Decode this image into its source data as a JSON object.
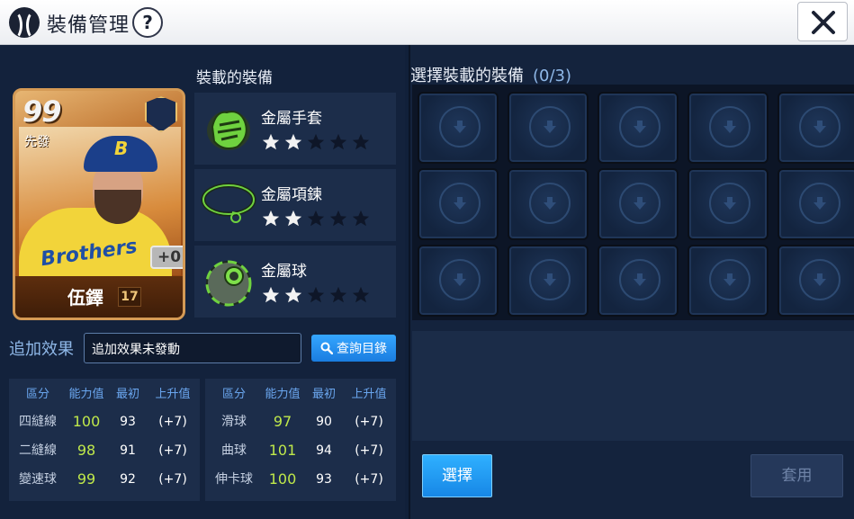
{
  "window": {
    "title": "裝備管理",
    "help_label": "?",
    "close_icon": "close-icon"
  },
  "player_card": {
    "rating": "99",
    "role": "先發",
    "name": "伍鐸",
    "number": "17",
    "upgrade": "+0",
    "jersey_text": "Brothers",
    "cap_letter": "B"
  },
  "equipped": {
    "header": "裝載的裝備",
    "items": [
      {
        "name": "金屬手套",
        "stars": 2,
        "max_stars": 5,
        "icon": "glove-icon"
      },
      {
        "name": "金屬項鍊",
        "stars": 2,
        "max_stars": 5,
        "icon": "necklace-icon"
      },
      {
        "name": "金屬球",
        "stars": 2,
        "max_stars": 5,
        "icon": "ball-icon"
      }
    ]
  },
  "bonus": {
    "label": "追加效果",
    "value": "追加效果未發動",
    "query_button": "查詢目錄"
  },
  "stats": {
    "headers": [
      "區分",
      "能力值",
      "最初",
      "上升值"
    ],
    "left": [
      {
        "name": "四縫線",
        "value": "100",
        "initial": "93",
        "increase": "(+7)"
      },
      {
        "name": "二縫線",
        "value": "98",
        "initial": "91",
        "increase": "(+7)"
      },
      {
        "name": "變速球",
        "value": "99",
        "initial": "92",
        "increase": "(+7)"
      }
    ],
    "right": [
      {
        "name": "滑球",
        "value": "97",
        "initial": "90",
        "increase": "(+7)"
      },
      {
        "name": "曲球",
        "value": "101",
        "initial": "94",
        "increase": "(+7)"
      },
      {
        "name": "伸卡球",
        "value": "100",
        "initial": "93",
        "increase": "(+7)"
      }
    ]
  },
  "selection": {
    "title": "選擇裝載的裝備",
    "count": "(0/3)",
    "select_button": "選擇",
    "apply_button": "套用"
  },
  "colors": {
    "accent_blue": "#1a8ae8",
    "stat_value_green": "#bfe84a",
    "panel_bg": "#13223c"
  }
}
